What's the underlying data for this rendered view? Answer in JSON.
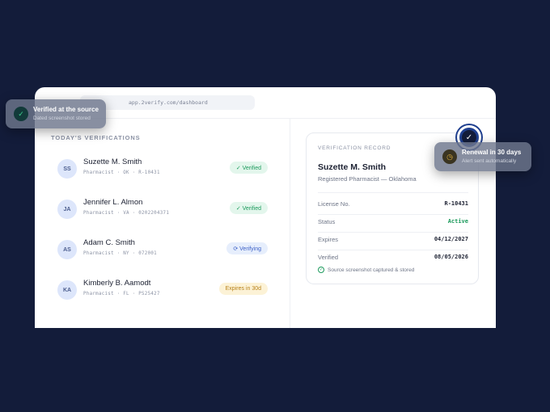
{
  "browser": {
    "url": "app.2verify.com/dashboard"
  },
  "list": {
    "title": "TODAY'S VERIFICATIONS",
    "rows": [
      {
        "initials": "SS",
        "name": "Suzette M. Smith",
        "meta": "Pharmacist · OK · R-10431",
        "status": "✓ Verified",
        "status_type": "verified"
      },
      {
        "initials": "JA",
        "name": "Jennifer L. Almon",
        "meta": "Pharmacist · VA · 0202204371",
        "status": "✓ Verified",
        "status_type": "verified"
      },
      {
        "initials": "AS",
        "name": "Adam C. Smith",
        "meta": "Pharmacist · NY · 072001",
        "status": "⟳ Verifying",
        "status_type": "verifying"
      },
      {
        "initials": "KA",
        "name": "Kimberly B. Aamodt",
        "meta": "Pharmacist · FL · PS25427",
        "status": "Expires in 30d",
        "status_type": "expires"
      }
    ]
  },
  "record": {
    "label": "VERIFICATION RECORD",
    "name": "Suzette M. Smith",
    "subtitle": "Registered Pharmacist — Oklahoma",
    "fields": [
      {
        "label": "License No.",
        "value": "R-10431"
      },
      {
        "label": "Status",
        "value": "Active"
      },
      {
        "label": "Expires",
        "value": "04/12/2027"
      },
      {
        "label": "Verified",
        "value": "08/05/2026"
      }
    ],
    "footer": "Source screenshot captured & stored"
  },
  "float_left": {
    "title": "Verified at the source",
    "subtitle": "Dated screenshot stored"
  },
  "float_right": {
    "title": "Renewal in 30 days",
    "subtitle": "Alert sent automatically"
  },
  "colors": {
    "background": "#131c3a",
    "verified": "#1c9a5c",
    "verifying": "#3a5fc6",
    "expires": "#b88118"
  }
}
